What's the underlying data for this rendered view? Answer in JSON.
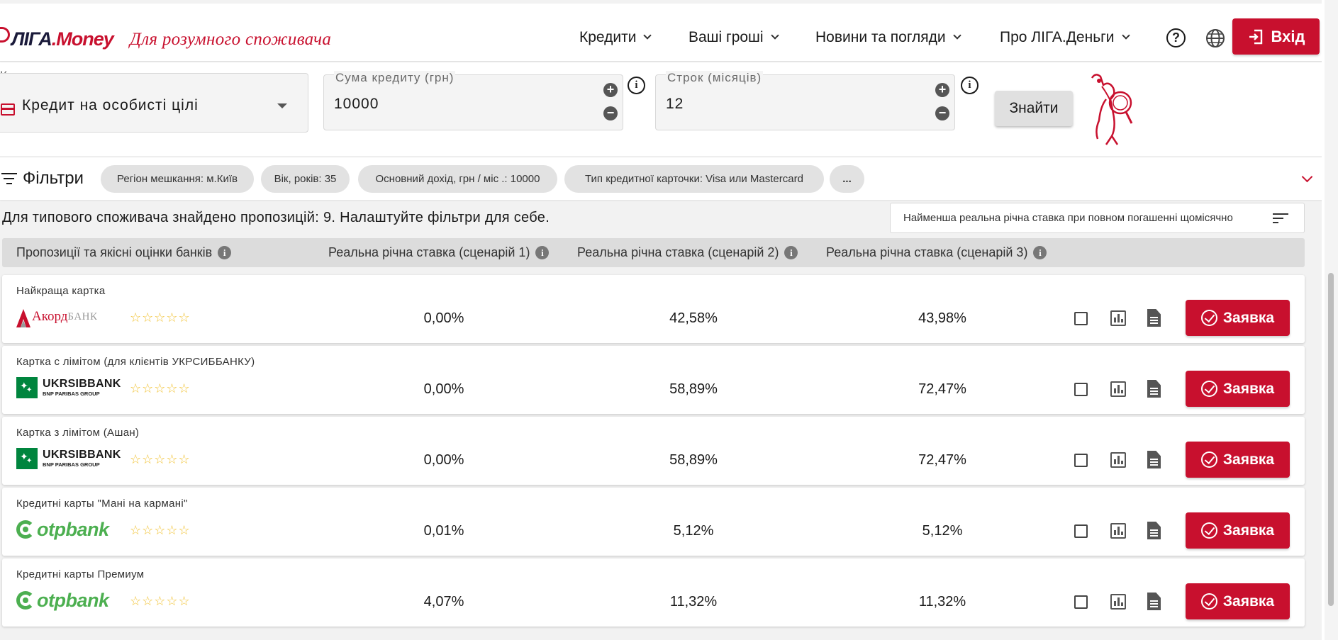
{
  "header": {
    "logo_liga": "ЛІГА",
    "logo_money": ".Money",
    "tagline": "Для розумного споживача",
    "nav": [
      "Кредити",
      "Ваші гроші",
      "Новини та погляди",
      "Про ЛІГА.Деньги"
    ],
    "help_icon": "help-circle-icon",
    "globe_icon": "globe-icon",
    "login_label": "Вхід",
    "accent_color": "#c8102e"
  },
  "search": {
    "credit_label": "Кредит",
    "credit_value": "Кредит на особисті цілі",
    "amount_label": "Сума кредиту (грн)",
    "amount_value": "10000",
    "term_label": "Строк (місяців)",
    "term_value": "12",
    "find_label": "Знайти"
  },
  "filters": {
    "title": "Фільтри",
    "chips": [
      "Регіон мешкання: м.Київ",
      "Вік, років: 35",
      "Основний дохід, грн / міс .: 10000",
      "Тип кредитної карточки: Visa или Mastercard",
      "..."
    ]
  },
  "results": {
    "summary": "Для типового споживача знайдено пропозицій: 9. Налаштуйте фільтри для себе.",
    "sort_label": "Найменша реальна річна ставка при повном погашенні щомісячно",
    "columns": [
      "Пропозиції та якісні оцінки банків",
      "Реальна річна ставка (сценарій 1)",
      "Реальна річна ставка (сценарій 2)",
      "Реальна річна ставка (сценарій 3)"
    ],
    "apply_label": "Заявка",
    "rows": [
      {
        "title": "Найкраща картка",
        "bank": "akord",
        "rate1": "0,00%",
        "rate2": "42,58%",
        "rate3": "43,98%"
      },
      {
        "title": "Картка с лімітом (для клієнтів УКРСИББАНКУ)",
        "bank": "ukrsib",
        "rate1": "0,00%",
        "rate2": "58,89%",
        "rate3": "72,47%"
      },
      {
        "title": "Картка з лімітом (Ашан)",
        "bank": "ukrsib",
        "rate1": "0,00%",
        "rate2": "58,89%",
        "rate3": "72,47%"
      },
      {
        "title": "Кредитні карты \"Мані на кармані\"",
        "bank": "otp",
        "rate1": "0,01%",
        "rate2": "5,12%",
        "rate3": "5,12%"
      },
      {
        "title": "Кредитні карты Премиум",
        "bank": "otp",
        "rate1": "4,07%",
        "rate2": "11,32%",
        "rate3": "11,32%"
      }
    ]
  },
  "banks": {
    "akord": {
      "name": "Акорд",
      "suffix": "БАНК"
    },
    "ukrsib": {
      "name": "UKRSIBBANK",
      "sub": "BNP PARIBAS GROUP"
    },
    "otp": {
      "name": "otpbank"
    }
  },
  "stars": "☆☆☆☆☆"
}
